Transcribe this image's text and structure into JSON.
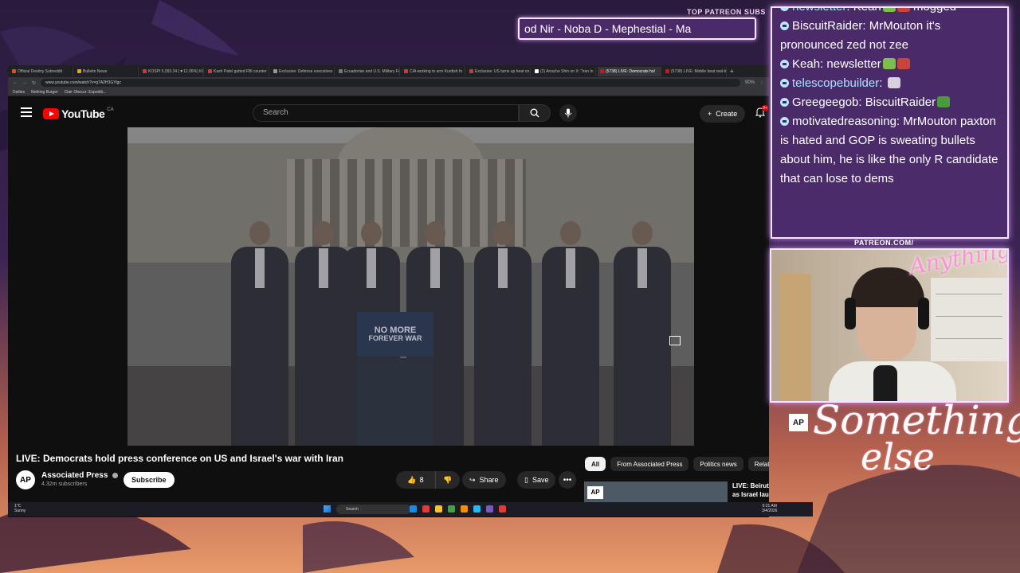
{
  "overlay": {
    "patreon_label": "TOP PATREON SUBS",
    "patreon_ticker": "od Nir - Noba D - Mephestial - Ma",
    "patreon_url": "PATREON.COM/",
    "brand_line1": "Something",
    "brand_line2": "else",
    "webcam_watermark": "Anything else"
  },
  "browser": {
    "tabs": [
      {
        "label": "Official Destiny Subreddit",
        "color": "#ff4500"
      },
      {
        "label": "Bulletin News",
        "color": "#f4a300"
      },
      {
        "label": "KOSPI 5,093.34 (▼12.06%) KOS",
        "color": "#d33"
      },
      {
        "label": "Kash Patel gutted FBI counter",
        "color": "#d33"
      },
      {
        "label": "Exclusive: Defense executives",
        "color": "#999"
      },
      {
        "label": "Ecuadorian and U.S. Military Fo",
        "color": "#777"
      },
      {
        "label": "CIA working to arm Kurdish fo",
        "color": "#d33"
      },
      {
        "label": "Exclusive: US turns up heat on",
        "color": "#d33"
      },
      {
        "label": "(2) Arrache Shin on X: \"Iran In",
        "color": "#fff"
      },
      {
        "label": "(5738) LIVE: Democrats hol",
        "color": "#ff0000",
        "active": true
      },
      {
        "label": "(5738) LIVE: Mobile beat real-ti",
        "color": "#ff0000"
      }
    ],
    "new_tab": "+",
    "url": "www.youtube.com/watch?v=g7A2H3GYlgc",
    "zoom": "90%",
    "bookmarks": [
      "Dailies",
      "Nothing Burger",
      "Clair Obscur: Expediti..."
    ]
  },
  "youtube": {
    "logo_text": "YouTube",
    "region": "CA",
    "search_placeholder": "Search",
    "create_label": "Create",
    "notification_count": "9+",
    "video": {
      "sign_line1": "NO MORE",
      "sign_line2": "FOREVER WAR",
      "title": "LIVE: Democrats hold press conference on US and Israel's war with Iran",
      "channel": "Associated Press",
      "channel_avatar": "AP",
      "subscribers": "4.32m subscribers",
      "subscribe_label": "Subscribe",
      "likes": "8",
      "share_label": "Share",
      "save_label": "Save"
    },
    "chips": [
      {
        "label": "All",
        "active": true
      },
      {
        "label": "From Associated Press"
      },
      {
        "label": "Politics news"
      },
      {
        "label": "Relate"
      }
    ],
    "recommendation": {
      "thumb_label": "AP",
      "title": "LIVE: Beirut skyline as Israel launches..."
    }
  },
  "ap_watermark": "AP",
  "taskbar": {
    "weather_temp": "1°C",
    "weather_desc": "Sunny",
    "search_label": "Search",
    "time": "9:21 AM",
    "date": "3/4/2026"
  },
  "chat": [
    {
      "user": "newsletter",
      "text": "Kean",
      "after": "mogged",
      "user_color": "#a9e2ff",
      "emote_colors": [
        "#7cbf4a",
        "#c9443a"
      ]
    },
    {
      "user": "BiscuitRaider",
      "text": "MrMouton it's pronounced zed not zee",
      "user_color": "#ffffff"
    },
    {
      "user": "Keah",
      "text": "newsletter",
      "user_color": "#ffffff",
      "emote_colors": [
        "#7cbf4a",
        "#c9443a"
      ]
    },
    {
      "user": "telescopebuilder",
      "text": "",
      "user_color": "#a9e2ff",
      "emote_colors": [
        "#d6d0e0"
      ]
    },
    {
      "user": "Greegeegob",
      "text": "BiscuitRaider",
      "user_color": "#ffffff",
      "emote_colors": [
        "#4a9a3a"
      ]
    },
    {
      "user": "motivatedreasoning",
      "text": "MrMouton paxton is hated and GOP is sweating bullets about him, he is like the only R candidate that can lose to dems",
      "user_color": "#ffffff"
    }
  ]
}
